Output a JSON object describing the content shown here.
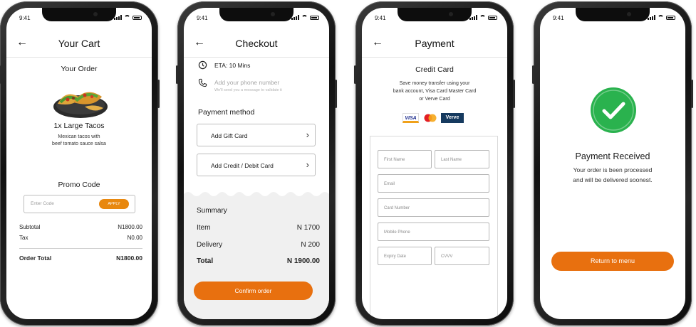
{
  "status_time": "9:41",
  "colors": {
    "accent": "#e8700f",
    "success": "#2ab24e",
    "summary_bg": "#f0f0f0"
  },
  "cart": {
    "title": "Your Cart",
    "order_heading": "Your Order",
    "item_name": "1x Large Tacos",
    "item_desc_line1": "Mexican tacos with",
    "item_desc_line2": "beef tomato sauce salsa",
    "promo_heading": "Promo Code",
    "promo_placeholder": "Enter Code",
    "apply_label": "APPLY",
    "subtotal_label": "Subtotal",
    "subtotal_value": "N1800.00",
    "tax_label": "Tax",
    "tax_value": "N0.00",
    "total_label": "Order Total",
    "total_value": "N1800.00"
  },
  "checkout": {
    "title": "Checkout",
    "eta": "ETA: 10 Mins",
    "phone_placeholder": "Add your phone number",
    "phone_hint": "We'll send you a message to validate it",
    "payment_heading": "Payment method",
    "option_gift": "Add Gift Card",
    "option_card": "Add Credit / Debit Card",
    "summary_heading": "Summary",
    "item_label": "Item",
    "item_value": "N 1700",
    "delivery_label": "Delivery",
    "delivery_value": "N 200",
    "total_label": "Total",
    "total_value": "N 1900.00",
    "confirm_label": "Confirm order"
  },
  "payment": {
    "title": "Payment",
    "heading": "Credit Card",
    "desc_line1": "Save money transfer using your",
    "desc_line2": "bank account, Visa Card Master Card",
    "desc_line3": "or Verve Card",
    "logo_visa": "VISA",
    "logo_verve": "Verve",
    "first_name": "First Name",
    "last_name": "Last Name",
    "email": "Email",
    "card_number": "Card Number",
    "mobile": "Mobile Phone",
    "expiry": "Expiry Date",
    "cvv": "CVVV"
  },
  "received": {
    "heading": "Payment Received",
    "line1": "Your order is been processed",
    "line2": "and will be delivered soonest.",
    "button": "Return to menu"
  }
}
